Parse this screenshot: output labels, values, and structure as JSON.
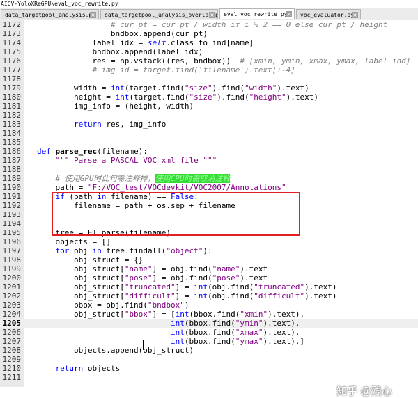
{
  "window": {
    "title": "AICV-YoloXReGPU\\eval_voc_rewrite.py"
  },
  "tabs": [
    {
      "label": "data_targetpool_analysis.py",
      "active": false
    },
    {
      "label": "data_targetpool_analysis_overlap.py",
      "active": false
    },
    {
      "label": "eval_voc_rewrite.py",
      "active": true
    },
    {
      "label": "voc_evaluator.py",
      "active": false
    }
  ],
  "tab_close_glyph": "×",
  "editor": {
    "current_line": "1205",
    "lines": [
      {
        "num": "1172",
        "indent": 16,
        "tokens": [
          {
            "t": "# cur_pt = cur_pt / width if i % 2 == 0 else cur_pt / height",
            "c": "comment"
          }
        ]
      },
      {
        "num": "1173",
        "indent": 16,
        "tokens": [
          {
            "t": "bndbox.append(cur_pt)",
            "c": ""
          }
        ]
      },
      {
        "num": "1174",
        "indent": 12,
        "tokens": [
          {
            "t": "label_idx = ",
            "c": ""
          },
          {
            "t": "self",
            "c": "self"
          },
          {
            "t": ".class_to_ind[name]",
            "c": ""
          }
        ]
      },
      {
        "num": "1175",
        "indent": 12,
        "tokens": [
          {
            "t": "bndbox.append(label_idx)",
            "c": ""
          }
        ]
      },
      {
        "num": "1176",
        "indent": 12,
        "tokens": [
          {
            "t": "res = np.vstack((res, bndbox))  ",
            "c": ""
          },
          {
            "t": "# [xmin, ymin, xmax, ymax, label_ind]",
            "c": "comment"
          }
        ]
      },
      {
        "num": "1177",
        "indent": 12,
        "tokens": [
          {
            "t": "# img_id = target.find('filename').text[:-4]",
            "c": "comment"
          }
        ]
      },
      {
        "num": "1178",
        "indent": 0,
        "tokens": []
      },
      {
        "num": "1179",
        "indent": 8,
        "tokens": [
          {
            "t": "width = ",
            "c": ""
          },
          {
            "t": "int",
            "c": "builtin"
          },
          {
            "t": "(target.find(",
            "c": ""
          },
          {
            "t": "\"size\"",
            "c": "string"
          },
          {
            "t": ").find(",
            "c": ""
          },
          {
            "t": "\"width\"",
            "c": "string"
          },
          {
            "t": ").text)",
            "c": ""
          }
        ]
      },
      {
        "num": "1180",
        "indent": 8,
        "tokens": [
          {
            "t": "height = ",
            "c": ""
          },
          {
            "t": "int",
            "c": "builtin"
          },
          {
            "t": "(target.find(",
            "c": ""
          },
          {
            "t": "\"size\"",
            "c": "string"
          },
          {
            "t": ").find(",
            "c": ""
          },
          {
            "t": "\"height\"",
            "c": "string"
          },
          {
            "t": ").text)",
            "c": ""
          }
        ]
      },
      {
        "num": "1181",
        "indent": 8,
        "tokens": [
          {
            "t": "img_info = (height, width)",
            "c": ""
          }
        ]
      },
      {
        "num": "1182",
        "indent": 0,
        "tokens": []
      },
      {
        "num": "1183",
        "indent": 8,
        "tokens": [
          {
            "t": "return",
            "c": "keyword"
          },
          {
            "t": " res, img_info",
            "c": ""
          }
        ]
      },
      {
        "num": "1184",
        "indent": 0,
        "tokens": []
      },
      {
        "num": "1185",
        "indent": 0,
        "tokens": []
      },
      {
        "num": "1186",
        "indent": 0,
        "tokens": [
          {
            "t": "def",
            "c": "keyword"
          },
          {
            "t": " ",
            "c": ""
          },
          {
            "t": "parse_rec",
            "c": "defname"
          },
          {
            "t": "(filename):",
            "c": ""
          }
        ]
      },
      {
        "num": "1187",
        "indent": 4,
        "tokens": [
          {
            "t": "\"\"\" Parse a PASCAL VOC xml file \"\"\"",
            "c": "string"
          }
        ]
      },
      {
        "num": "1188",
        "indent": 0,
        "tokens": []
      },
      {
        "num": "1189",
        "indent": 4,
        "tokens": [
          {
            "t": "# 使用GPU时此句需注释掉，",
            "c": "comment"
          },
          {
            "t": "使用CPU时需取消注释",
            "c": "hl"
          }
        ]
      },
      {
        "num": "1190",
        "indent": 4,
        "tokens": [
          {
            "t": "path = ",
            "c": ""
          },
          {
            "t": "\"F:/VOC_test/VOCdevkit/VOC2007/Annotations\"",
            "c": "string"
          }
        ]
      },
      {
        "num": "1191",
        "indent": 4,
        "tokens": [
          {
            "t": "if",
            "c": "keyword"
          },
          {
            "t": " (path ",
            "c": ""
          },
          {
            "t": "in",
            "c": "keyword"
          },
          {
            "t": " filename) == ",
            "c": ""
          },
          {
            "t": "False",
            "c": "keyword"
          },
          {
            "t": ":",
            "c": ""
          }
        ]
      },
      {
        "num": "1192",
        "indent": 8,
        "tokens": [
          {
            "t": "filename = path + os.sep + filename",
            "c": ""
          }
        ]
      },
      {
        "num": "1193",
        "indent": 0,
        "tokens": []
      },
      {
        "num": "1194",
        "indent": 0,
        "tokens": []
      },
      {
        "num": "1195",
        "indent": 4,
        "tokens": [
          {
            "t": "tree = ET.parse(filename)",
            "c": ""
          }
        ]
      },
      {
        "num": "1196",
        "indent": 4,
        "tokens": [
          {
            "t": "objects = []",
            "c": ""
          }
        ]
      },
      {
        "num": "1197",
        "indent": 4,
        "tokens": [
          {
            "t": "for",
            "c": "keyword"
          },
          {
            "t": " obj ",
            "c": ""
          },
          {
            "t": "in",
            "c": "keyword"
          },
          {
            "t": " tree.findall(",
            "c": ""
          },
          {
            "t": "\"object\"",
            "c": "string"
          },
          {
            "t": "):",
            "c": ""
          }
        ]
      },
      {
        "num": "1198",
        "indent": 8,
        "tokens": [
          {
            "t": "obj_struct = {}",
            "c": ""
          }
        ]
      },
      {
        "num": "1199",
        "indent": 8,
        "tokens": [
          {
            "t": "obj_struct[",
            "c": ""
          },
          {
            "t": "\"name\"",
            "c": "string"
          },
          {
            "t": "] = obj.find(",
            "c": ""
          },
          {
            "t": "\"name\"",
            "c": "string"
          },
          {
            "t": ").text",
            "c": ""
          }
        ]
      },
      {
        "num": "1200",
        "indent": 8,
        "tokens": [
          {
            "t": "obj_struct[",
            "c": ""
          },
          {
            "t": "\"pose\"",
            "c": "string"
          },
          {
            "t": "] = obj.find(",
            "c": ""
          },
          {
            "t": "\"pose\"",
            "c": "string"
          },
          {
            "t": ").text",
            "c": ""
          }
        ]
      },
      {
        "num": "1201",
        "indent": 8,
        "tokens": [
          {
            "t": "obj_struct[",
            "c": ""
          },
          {
            "t": "\"truncated\"",
            "c": "string"
          },
          {
            "t": "] = ",
            "c": ""
          },
          {
            "t": "int",
            "c": "builtin"
          },
          {
            "t": "(obj.find(",
            "c": ""
          },
          {
            "t": "\"truncated\"",
            "c": "string"
          },
          {
            "t": ").text)",
            "c": ""
          }
        ]
      },
      {
        "num": "1202",
        "indent": 8,
        "tokens": [
          {
            "t": "obj_struct[",
            "c": ""
          },
          {
            "t": "\"difficult\"",
            "c": "string"
          },
          {
            "t": "] = ",
            "c": ""
          },
          {
            "t": "int",
            "c": "builtin"
          },
          {
            "t": "(obj.find(",
            "c": ""
          },
          {
            "t": "\"difficult\"",
            "c": "string"
          },
          {
            "t": ").text)",
            "c": ""
          }
        ]
      },
      {
        "num": "1203",
        "indent": 8,
        "tokens": [
          {
            "t": "bbox = obj.find(",
            "c": ""
          },
          {
            "t": "\"bndbox\"",
            "c": "string"
          },
          {
            "t": ")",
            "c": ""
          }
        ]
      },
      {
        "num": "1204",
        "indent": 8,
        "tokens": [
          {
            "t": "obj_struct[",
            "c": ""
          },
          {
            "t": "\"bbox\"",
            "c": "string"
          },
          {
            "t": "] = [",
            "c": ""
          },
          {
            "t": "int",
            "c": "builtin"
          },
          {
            "t": "(bbox.find(",
            "c": ""
          },
          {
            "t": "\"xmin\"",
            "c": "string"
          },
          {
            "t": ").text),",
            "c": ""
          }
        ]
      },
      {
        "num": "1205",
        "indent": 29,
        "tokens": [
          {
            "t": "int",
            "c": "builtin"
          },
          {
            "t": "(bbox.find(",
            "c": ""
          },
          {
            "t": "\"ymin\"",
            "c": "string"
          },
          {
            "t": ").text),",
            "c": ""
          }
        ]
      },
      {
        "num": "1206",
        "indent": 29,
        "tokens": [
          {
            "t": "int",
            "c": "builtin"
          },
          {
            "t": "(bbox.find(",
            "c": ""
          },
          {
            "t": "\"xmax\"",
            "c": "string"
          },
          {
            "t": ").text),",
            "c": ""
          }
        ]
      },
      {
        "num": "1207",
        "indent": 29,
        "tokens": [
          {
            "t": "int",
            "c": "builtin"
          },
          {
            "t": "(bbox.find(",
            "c": ""
          },
          {
            "t": "\"ymax\"",
            "c": "string"
          },
          {
            "t": ").text),]",
            "c": ""
          }
        ]
      },
      {
        "num": "1208",
        "indent": 8,
        "tokens": [
          {
            "t": "objects.append(obj_struct)",
            "c": ""
          }
        ]
      },
      {
        "num": "1209",
        "indent": 0,
        "tokens": []
      },
      {
        "num": "1210",
        "indent": 4,
        "tokens": [
          {
            "t": "return",
            "c": "keyword"
          },
          {
            "t": " objects",
            "c": ""
          }
        ]
      },
      {
        "num": "1211",
        "indent": 0,
        "tokens": []
      }
    ]
  },
  "watermark": {
    "text": "知乎 @残心"
  }
}
